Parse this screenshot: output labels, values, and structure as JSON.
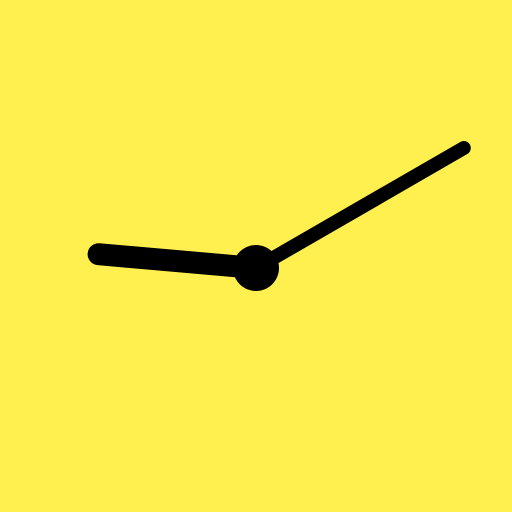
{
  "clock": {
    "time": {
      "hours": 9,
      "minutes": 10
    },
    "colors": {
      "background": "#fff04f",
      "hands": "#000000"
    },
    "icons": {
      "hour_hand": "hour-hand-icon",
      "minute_hand": "minute-hand-icon",
      "center_pin": "center-pin-icon"
    }
  }
}
